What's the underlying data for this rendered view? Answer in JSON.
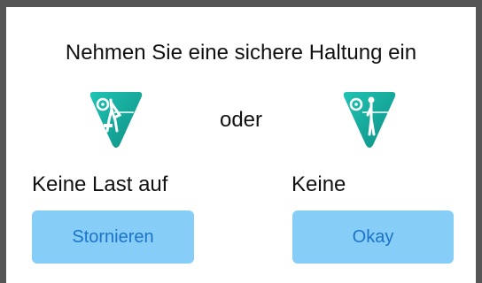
{
  "dialog": {
    "title": "Nehmen Sie eine sichere Haltung ein",
    "separator": "oder",
    "options": [
      {
        "label": "Keine Last auf",
        "icon": "leaning-posture-icon"
      },
      {
        "label": "Keine",
        "icon": "standing-posture-icon"
      }
    ],
    "buttons": {
      "cancel": "Stornieren",
      "ok": "Okay"
    }
  },
  "colors": {
    "backdrop": "#555555",
    "dialog_background": "#ffffff",
    "icon_teal": "#14a89a",
    "button_background": "#86cdf7",
    "button_text": "#1c74c9"
  }
}
